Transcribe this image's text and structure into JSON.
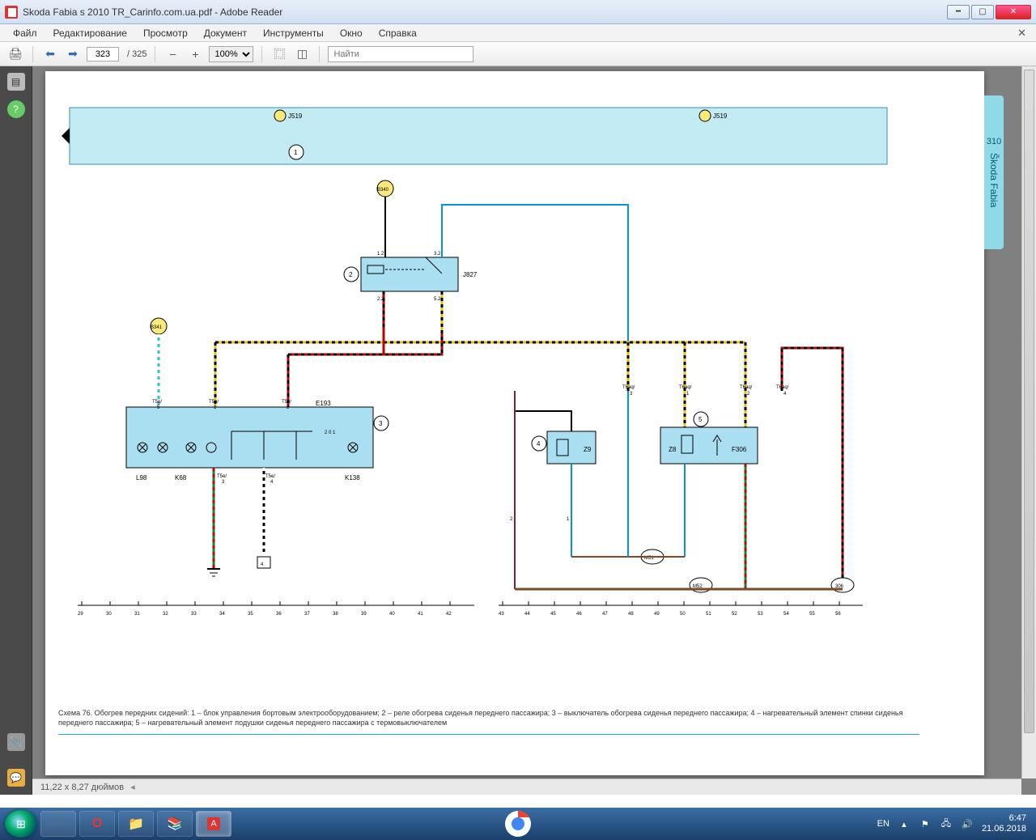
{
  "window": {
    "title": "Skoda Fabia s 2010 TR_Carinfo.com.ua.pdf - Adobe Reader"
  },
  "menu": {
    "items": [
      "Файл",
      "Редактирование",
      "Просмотр",
      "Документ",
      "Инструменты",
      "Окно",
      "Справка"
    ]
  },
  "toolbar": {
    "page_current": "323",
    "page_total": "/  325",
    "zoom": "100%",
    "find_placeholder": "Найти"
  },
  "doc": {
    "page_no": "310",
    "side_label": "Škoda Fabia",
    "dimensions": "11,22 x 8,27 дюймов",
    "caption": "Схема 76. Обогрев передних сидений: 1 – блок управления бортовым электрооборудованием; 2 – реле обогрева сиденья переднего пассажира; 3 – выключатель обогрева сиденья переднего пассажира; 4 – нагревательный элемент спинки сиденья переднего пассажира; 5 – нагревательный элемент подушки сиденья переднего пассажира с термовыключателем"
  },
  "diagram": {
    "top_refs": {
      "left": "J519",
      "right": "J519"
    },
    "circles": {
      "c1": "1",
      "c2": "2",
      "c3": "3",
      "c4": "4",
      "c5": "5"
    },
    "nodes": {
      "B340": "B340",
      "B341": "B341",
      "J827": "J827",
      "E193": "E193",
      "L98": "L98",
      "K68": "K68",
      "K138": "K138",
      "Z9": "Z9",
      "Z8": "Z8",
      "F306": "F306",
      "M51": "M51",
      "M52": "M52",
      "g306": "306",
      "g4": "4"
    },
    "pins": {
      "p12": "1.2",
      "p32": "3.2",
      "p22": "2.2",
      "p52": "5.2",
      "t5e5": "T5e/\n5",
      "t5e1": "T5e/\n1",
      "t5e2": "T5e/\n2",
      "t5e3": "T5e/\n3",
      "t5e4": "T5e/\n4",
      "t6aq3": "T6aq/\n3",
      "t6aq1": "T6aq/\n1",
      "t6aq2": "T6aq/\n2",
      "t6aq4": "T6aq/\n4",
      "n1": "1",
      "n2": "2",
      "pos201": "2 0 1"
    },
    "axis": {
      "start": 29,
      "end": 56
    }
  },
  "tray": {
    "lang": "EN",
    "time": "6:47",
    "date": "21.06.2018"
  }
}
